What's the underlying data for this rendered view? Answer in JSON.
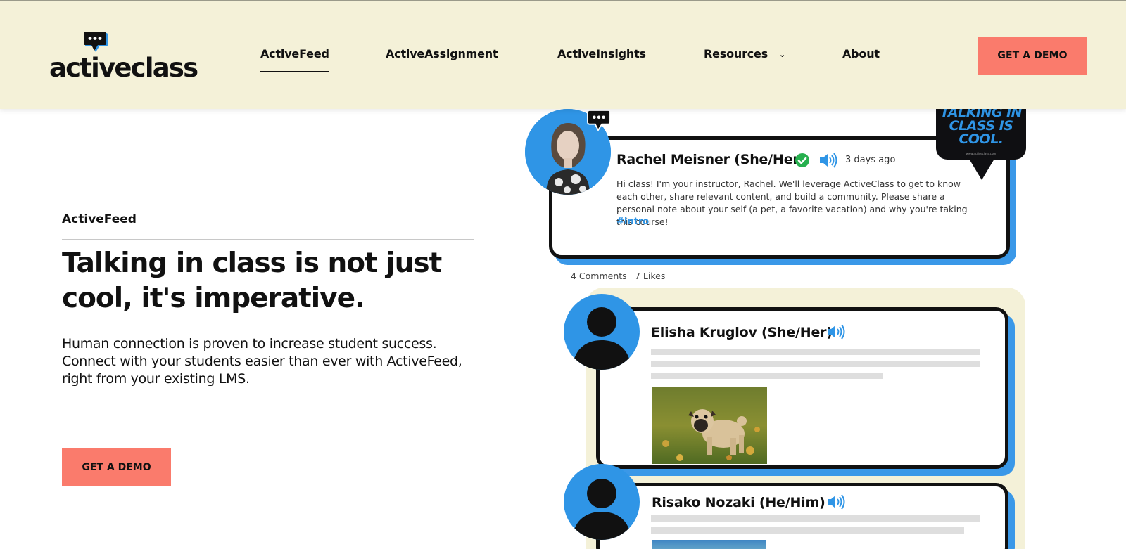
{
  "header": {
    "logo_text": "activeclass",
    "nav": [
      {
        "label": "ActiveFeed",
        "active": true
      },
      {
        "label": "ActiveAssignment",
        "active": false
      },
      {
        "label": "ActiveInsights",
        "active": false
      },
      {
        "label": "Resources",
        "active": false,
        "dropdown": true
      },
      {
        "label": "About",
        "active": false
      }
    ],
    "cta_label": "GET A DEMO"
  },
  "hero": {
    "eyebrow": "ActiveFeed",
    "headline": "Talking in class is not just cool, it's imperative.",
    "subcopy": "Human connection is proven to increase student success. Connect with your students easier than ever with ActiveFeed, right from your existing LMS.",
    "cta_label": "GET A DEMO"
  },
  "feed": {
    "poster_text": "TALKING IN CLASS IS COOL.",
    "poster_url": "www.activeclass.com",
    "posts": [
      {
        "author": "Rachel Meisner (She/Her)",
        "verified": true,
        "time": "3 days ago",
        "body": "Hi class! I'm your instructor, Rachel. We'll leverage ActiveClass to get to know each other, share relevant content, and build a community. Please share a personal note about your self (a pet, a favorite vacation) and why you're taking this course!",
        "hashtag": "#intro",
        "comments": "4 Comments",
        "likes": "7 Likes"
      },
      {
        "author": "Elisha Kruglov (She/Her)"
      },
      {
        "author": "Risako Nozaki (He/Him)"
      }
    ]
  },
  "colors": {
    "header_bg": "#f4f1d8",
    "accent_coral": "#fa7b6c",
    "accent_blue": "#2f95e6",
    "verified_green": "#27b04f",
    "text": "#111111"
  },
  "icons": [
    "chat-bubble-icon",
    "chevron-down-icon",
    "verified-check-icon",
    "speaker-icon",
    "user-silhouette-icon"
  ]
}
